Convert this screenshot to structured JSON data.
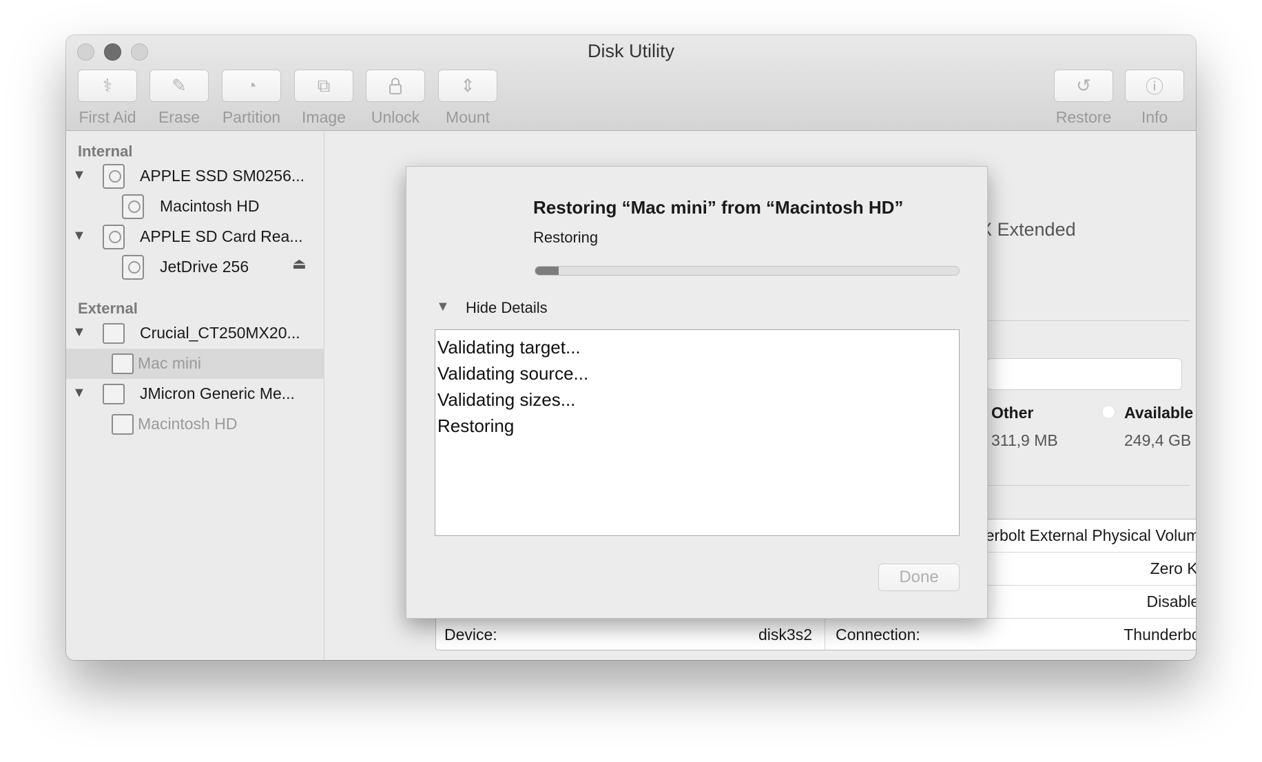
{
  "window": {
    "title": "Disk Utility"
  },
  "toolbar": {
    "buttons": [
      {
        "label": "First Aid",
        "icon": "stethoscope-icon"
      },
      {
        "label": "Erase",
        "icon": "erase-icon"
      },
      {
        "label": "Partition",
        "icon": "partition-icon"
      },
      {
        "label": "Image",
        "icon": "image-icon"
      },
      {
        "label": "Unlock",
        "icon": "lock-icon"
      },
      {
        "label": "Mount",
        "icon": "mount-icon"
      },
      {
        "label": "Restore",
        "icon": "restore-icon"
      },
      {
        "label": "Info",
        "icon": "info-icon"
      }
    ]
  },
  "sidebar": {
    "internal_header": "Internal",
    "external_header": "External",
    "internal": [
      {
        "label": "APPLE SSD SM0256..."
      },
      {
        "label": "Macintosh HD"
      },
      {
        "label": "APPLE SD Card Rea..."
      },
      {
        "label": "JetDrive 256"
      }
    ],
    "external": [
      {
        "label": "Crucial_CT250MX20..."
      },
      {
        "label": "Mac mini"
      },
      {
        "label": "JMicron Generic Me..."
      },
      {
        "label": "Macintosh HD"
      }
    ]
  },
  "background": {
    "format_partial": "X Extended",
    "legend": [
      {
        "label": "Other",
        "value": "311,9 MB"
      },
      {
        "label": "Available",
        "value": "249,4 GB"
      }
    ],
    "info_rows": [
      {
        "right_value": "erbolt External Physical Volume"
      },
      {
        "right_value": "Zero KB"
      },
      {
        "right_value": "Disabled"
      }
    ],
    "device_label": "Device:",
    "device_value": "disk3s2",
    "connection_label": "Connection:",
    "connection_value": "Thunderbolt"
  },
  "sheet": {
    "title": "Restoring “Mac mini” from “Macintosh HD”",
    "status": "Restoring",
    "progress": 0.055,
    "details_toggle": "Hide Details",
    "log": [
      "Validating target...",
      "Validating source...",
      "Validating sizes...",
      "Restoring"
    ],
    "done_label": "Done"
  }
}
